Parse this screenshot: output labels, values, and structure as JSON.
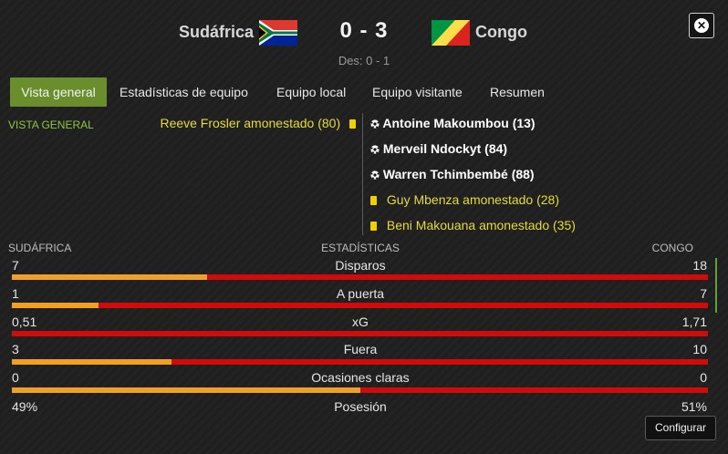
{
  "match": {
    "home_team": "Sudáfrica",
    "away_team": "Congo",
    "score": "0 - 3",
    "halftime": "Des: 0 - 1",
    "close_icon": "close-icon"
  },
  "tabs": [
    {
      "label": "Vista general",
      "active": true
    },
    {
      "label": "Estadísticas de equipo",
      "active": false
    },
    {
      "label": "Equipo local",
      "active": false
    },
    {
      "label": "Equipo visitante",
      "active": false
    },
    {
      "label": "Resumen",
      "active": false
    }
  ],
  "overview": {
    "section_label": "VISTA GENERAL",
    "home_events": [
      {
        "type": "yellow-card",
        "text": "Reeve Frosler amonestado (80)"
      }
    ],
    "away_events": [
      {
        "type": "goal",
        "text": "Antoine Makoumbou (13)"
      },
      {
        "type": "goal",
        "text": "Merveil Ndockyt (84)"
      },
      {
        "type": "goal",
        "text": "Warren Tchimbembé (88)"
      },
      {
        "type": "yellow-card",
        "text": "Guy Mbenza amonestado (28)"
      },
      {
        "type": "yellow-card",
        "text": "Beni Makouana amonestado (35)"
      }
    ]
  },
  "stats": {
    "home_label": "SUDÁFRICA",
    "title": "ESTADÍSTICAS",
    "away_label": "CONGO",
    "rows": [
      {
        "name": "Disparos",
        "home": "7",
        "away": "18",
        "home_share": 0.28
      },
      {
        "name": "A puerta",
        "home": "1",
        "away": "7",
        "home_share": 0.125
      },
      {
        "name": "xG",
        "home": "0,51",
        "away": "1,71",
        "home_share": 0.0
      },
      {
        "name": "Fuera",
        "home": "3",
        "away": "10",
        "home_share": 0.23
      },
      {
        "name": "Ocasiones claras",
        "home": "0",
        "away": "0",
        "home_share": 0.5
      },
      {
        "name": "Posesión",
        "home": "49%",
        "away": "51%"
      }
    ]
  },
  "colors": {
    "accent_green": "#6b8e2c",
    "home_bar": "#f0a024",
    "away_bar": "#d10a0a",
    "card_text": "#e6db3c"
  },
  "footer": {
    "configure_label": "Configurar"
  }
}
